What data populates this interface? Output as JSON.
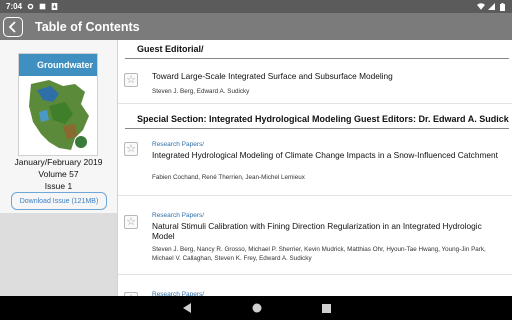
{
  "status_bar": {
    "time": "7:04"
  },
  "app_bar": {
    "title": "Table of Contents"
  },
  "issue": {
    "cover_title": "Groundwater",
    "date": "January/February 2019",
    "volume": "Volume 57",
    "number": "Issue 1",
    "download_label": "Download Issue (121MB)"
  },
  "sections": [
    {
      "title": "Guest Editorial/",
      "articles": [
        {
          "type": "",
          "title": "Toward Large-Scale Integrated Surface and Subsurface Modeling",
          "authors": "Steven J. Berg, Edward A. Sudicky"
        }
      ]
    },
    {
      "title": "Special Section: Integrated Hydrological Modeling Guest Editors: Dr. Edward A. Sudicky a...",
      "articles": [
        {
          "type": "Research Papers/",
          "title": "Integrated Hydrological Modeling of Climate Change Impacts in a Snow-Influenced Catchment",
          "authors": "Fabien Cochand, René Therrien, Jean-Michel Lemieux"
        },
        {
          "type": "Research Papers/",
          "title": "Natural Stimuli Calibration with Fining Direction Regularization in an Integrated Hydrologic Model",
          "authors": "Steven J. Berg, Nancy R. Grosso, Michael P. Sherrier, Kevin Mudrick, Matthias Ohr, Hyoun-Tae Hwang, Young-Jin Park, Michael V. Callaghan, Steven K. Frey, Edward A. Sudicky"
        },
        {
          "type": "Research Papers/",
          "title": "",
          "authors": ""
        }
      ]
    }
  ],
  "colors": {
    "app_bar": "#7b7b7b",
    "status_bar": "#5b5b5b",
    "link": "#2f6fa8",
    "cover_accent": "#3f8fc0"
  }
}
